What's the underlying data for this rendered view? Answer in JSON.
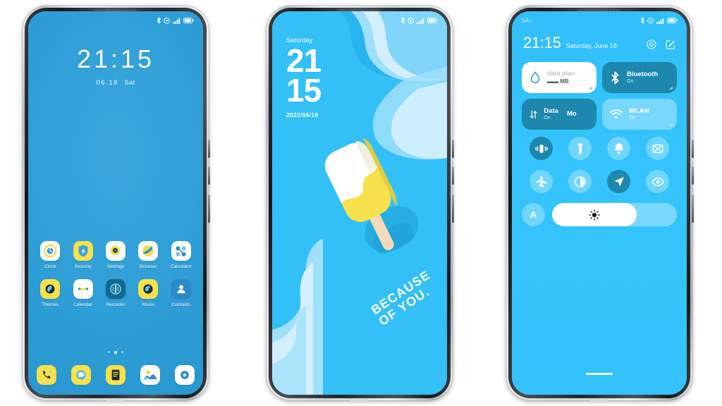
{
  "scene": {
    "background": "#ffffff",
    "phone_count": 3
  },
  "colors": {
    "phone1_wallpaper": "#2e9ed6",
    "phone2_wallpaper": "#33c0f7",
    "phone3_wallpaper": "#33c3fa",
    "accent_yellow": "#f6e04b",
    "accent_dark_teal": "#1d87ad",
    "popsicle_yellow": "#f7e04a",
    "popsicle_stick": "#f5d9b8",
    "wave_light": "#b8e7fb",
    "wave_lighter": "#d6f1fd",
    "wave_dark": "#1c9cd4"
  },
  "phone1": {
    "name": "home-screen",
    "statusbar": {
      "left": "",
      "icons": [
        "bluetooth-icon",
        "dnd-icon",
        "signal-icon",
        "battery-icon"
      ]
    },
    "clock": {
      "time": "21:15",
      "date": "06.18",
      "weekday": "Sat"
    },
    "apps_row1": [
      {
        "label": "Clock",
        "icon": "clock-icon"
      },
      {
        "label": "Security",
        "icon": "shield-icon"
      },
      {
        "label": "Settings",
        "icon": "gear-icon"
      },
      {
        "label": "Browser",
        "icon": "browser-icon"
      },
      {
        "label": "Calculator",
        "icon": "calculator-icon"
      }
    ],
    "apps_row2": [
      {
        "label": "Themes",
        "icon": "themes-icon"
      },
      {
        "label": "Calendar",
        "icon": "calendar-icon"
      },
      {
        "label": "Recorder",
        "icon": "recorder-icon"
      },
      {
        "label": "Music",
        "icon": "music-icon"
      },
      {
        "label": "Contacts",
        "icon": "contacts-icon"
      }
    ],
    "page_dots": {
      "count": 3,
      "active_index": 1
    },
    "dock": [
      {
        "label": "Phone",
        "icon": "phone-icon"
      },
      {
        "label": "Messages",
        "icon": "messages-icon"
      },
      {
        "label": "Notes",
        "icon": "notes-icon"
      },
      {
        "label": "Gallery",
        "icon": "gallery-icon"
      },
      {
        "label": "Camera",
        "icon": "camera-icon"
      }
    ]
  },
  "phone2": {
    "name": "lock-screen",
    "statusbar": {
      "left": "",
      "icons": [
        "bluetooth-icon",
        "dnd-icon",
        "signal-icon",
        "battery-icon"
      ]
    },
    "weekday": "Saturday",
    "hour": "21",
    "minute": "15",
    "date": "2022/06/18",
    "wallpaper_text_line1": "BECAUSE",
    "wallpaper_text_line2": "OF YOU.",
    "illustration": "popsicle-illustration"
  },
  "phone3": {
    "name": "control-center",
    "statusbar": {
      "left": "SA+",
      "icons": [
        "bluetooth-icon",
        "dnd-icon",
        "signal-icon",
        "battery-icon"
      ]
    },
    "header": {
      "time": "21:15",
      "date": "Saturday, June 18",
      "icons": [
        "settings-icon",
        "edit-icon"
      ]
    },
    "tiles": [
      {
        "title": "data plan",
        "subtitle": "MB",
        "value_dash": "▬▬",
        "state": "white",
        "icon": "data-drop-icon",
        "expandable": true
      },
      {
        "title": "Bluetooth",
        "subtitle": "On",
        "state": "dark",
        "icon": "bluetooth-icon",
        "expandable": true
      },
      {
        "title_a": "Data",
        "title_b": "Mo",
        "subtitle": "On",
        "state": "dark",
        "icon": "data-transfer-icon",
        "expandable": false
      },
      {
        "title": "WLAN",
        "subtitle": "Off",
        "state": "light",
        "icon": "wifi-icon",
        "expandable": true
      }
    ],
    "toggles_row1": [
      {
        "name": "vibrate-icon",
        "active": true
      },
      {
        "name": "flashlight-icon",
        "active": false
      },
      {
        "name": "bell-icon",
        "active": false
      },
      {
        "name": "screenshot-icon",
        "active": false
      }
    ],
    "toggles_row2": [
      {
        "name": "airplane-icon",
        "active": false
      },
      {
        "name": "dark-mode-icon",
        "active": false
      },
      {
        "name": "location-icon",
        "active": true
      },
      {
        "name": "eye-care-icon",
        "active": false
      }
    ],
    "brightness": {
      "auto_label": "A",
      "icon": "brightness-icon",
      "percent": 68
    },
    "drag_handle": "drag-handle"
  }
}
